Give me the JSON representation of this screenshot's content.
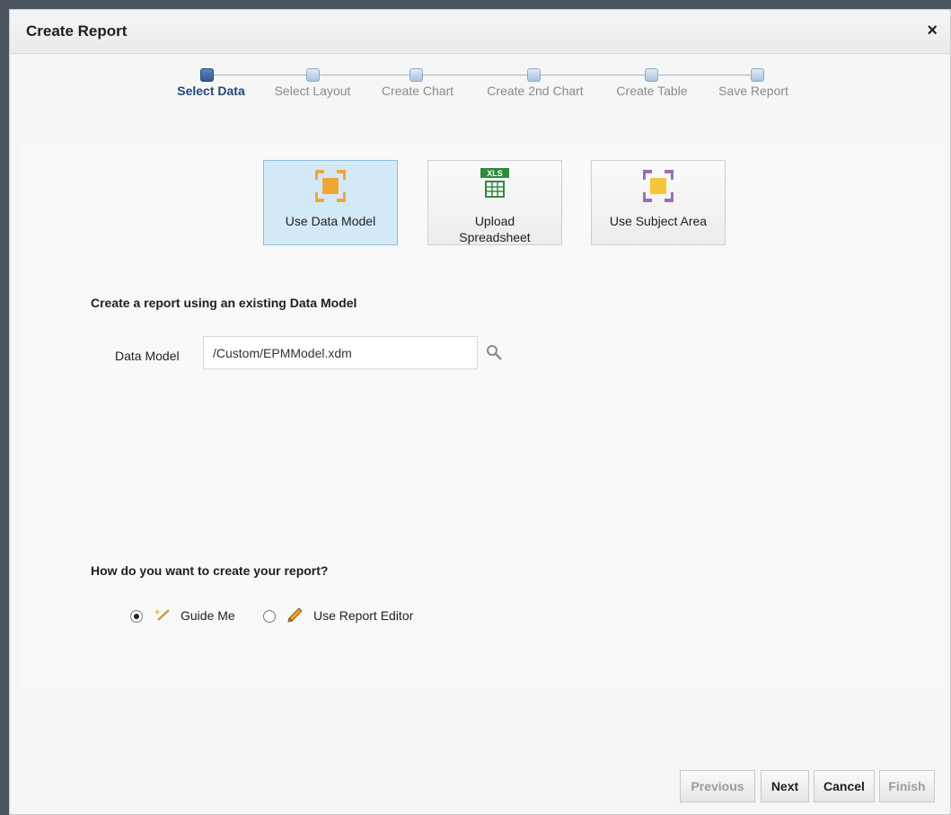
{
  "dialog": {
    "title": "Create Report",
    "close_glyph": "×"
  },
  "train": {
    "stops": [
      {
        "label": "Select Data",
        "active": true
      },
      {
        "label": "Select Layout",
        "active": false
      },
      {
        "label": "Create Chart",
        "active": false
      },
      {
        "label": "Create 2nd Chart",
        "active": false
      },
      {
        "label": "Create Table",
        "active": false
      },
      {
        "label": "Save Report",
        "active": false
      }
    ]
  },
  "sources": [
    {
      "label": "Use Data Model",
      "icon": "data-model-icon",
      "selected": true
    },
    {
      "label": "Upload Spreadsheet",
      "icon": "xls-spreadsheet-icon",
      "badge": "XLS",
      "selected": false
    },
    {
      "label": "Use Subject Area",
      "icon": "subject-area-icon",
      "selected": false
    }
  ],
  "data_model": {
    "section_title": "Create a report using an existing Data Model",
    "field_label": "Data Model",
    "value": "/Custom/EPMModel.xdm"
  },
  "create_mode": {
    "question": "How do you want to create your report?",
    "options": [
      {
        "label": "Guide Me",
        "icon": "magic-wand-icon",
        "checked": true
      },
      {
        "label": "Use Report Editor",
        "icon": "pencil-icon",
        "checked": false
      }
    ]
  },
  "footer": {
    "previous": {
      "label": "Previous",
      "enabled": false
    },
    "next": {
      "label": "Next",
      "enabled": true
    },
    "cancel": {
      "label": "Cancel",
      "enabled": true
    },
    "finish": {
      "label": "Finish",
      "enabled": false
    }
  },
  "colors": {
    "active_step": "#23467a",
    "selected_tile": "#d4e9f8",
    "data_model_orange": "#f0a637",
    "subject_area_purple": "#9b6fb8",
    "xls_green": "#2e8b3c"
  }
}
